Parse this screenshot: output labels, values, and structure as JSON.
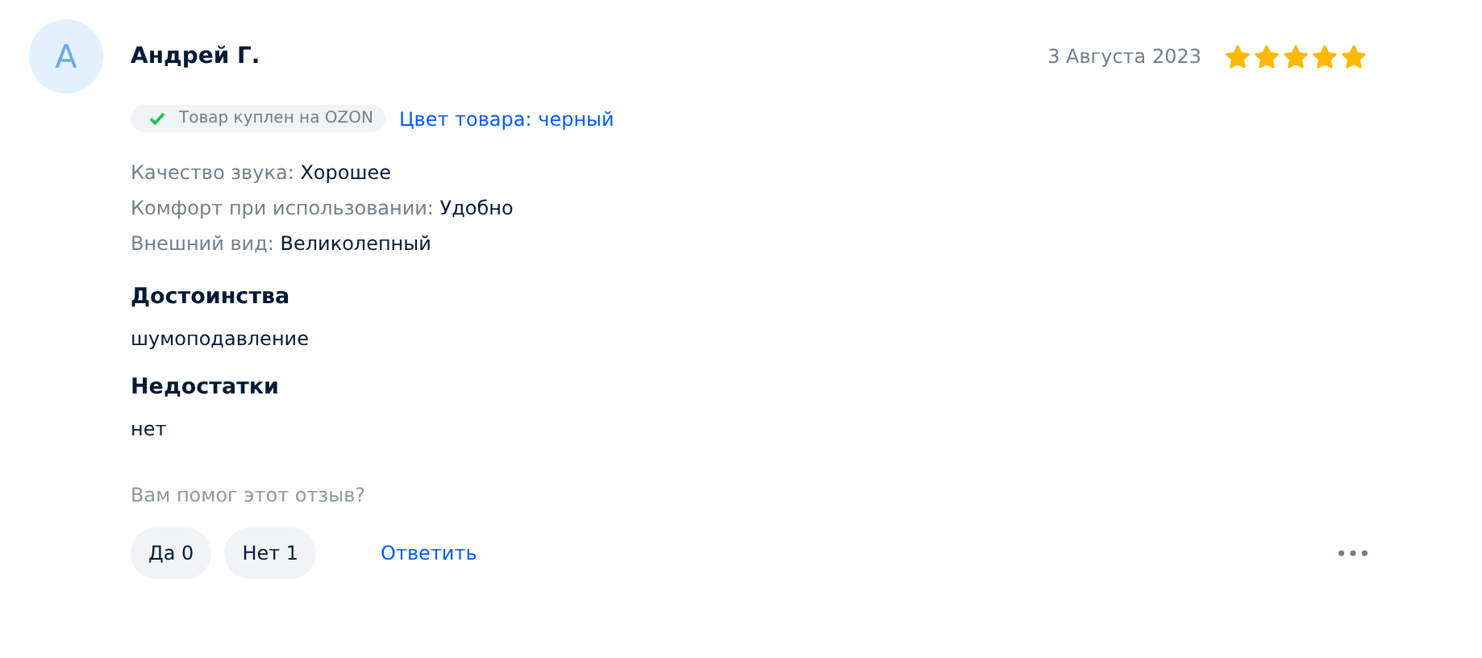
{
  "review": {
    "avatar_letter": "А",
    "author": "Андрей Г.",
    "date": "3 Августа 2023",
    "stars": 5,
    "badge": "Товар куплен на OZON",
    "variant": "Цвет товара: черный",
    "attributes": [
      {
        "label": "Качество звука:",
        "value": "Хорошее"
      },
      {
        "label": "Комфорт при использовании:",
        "value": "Удобно"
      },
      {
        "label": "Внешний вид:",
        "value": "Великолепный"
      }
    ],
    "sections": [
      {
        "title": "Достоинства",
        "text": "шумоподавление"
      },
      {
        "title": "Недостатки",
        "text": "нет"
      }
    ],
    "helpful_question": "Вам помог этот отзыв?",
    "votes": [
      {
        "label": "Да 0"
      },
      {
        "label": "Нет 1"
      }
    ],
    "reply": "Ответить"
  }
}
